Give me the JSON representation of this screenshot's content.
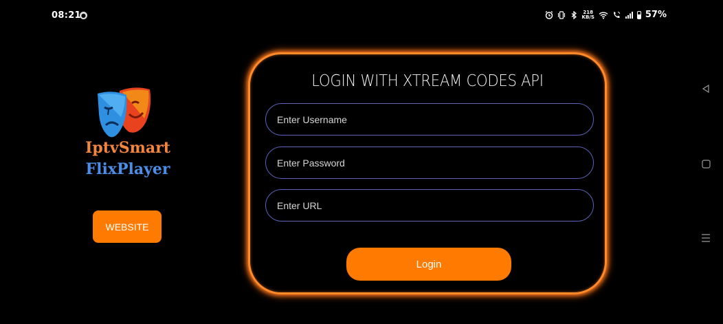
{
  "status_bar": {
    "time": "08:21",
    "net_speed_value": "218",
    "net_speed_unit": "KB/S",
    "battery_percent": "57%"
  },
  "brand": {
    "line1": "IptvSmart",
    "line2": "FlixPlayer",
    "logo_icon": "theater-masks-icon",
    "color_line1": "#f2863e",
    "color_line2": "#4a8ee8"
  },
  "website_button": {
    "label": "WEBSITE"
  },
  "login_panel": {
    "title": "LOGIN WITH XTREAM CODES API",
    "username_placeholder": "Enter Username",
    "password_placeholder": "Enter Password",
    "url_placeholder": "Enter URL",
    "login_label": "Login",
    "accent_color": "#ff7a00",
    "field_border_color": "#5c63b8"
  },
  "nav_keys": [
    "back-icon",
    "home-icon",
    "recents-icon"
  ]
}
